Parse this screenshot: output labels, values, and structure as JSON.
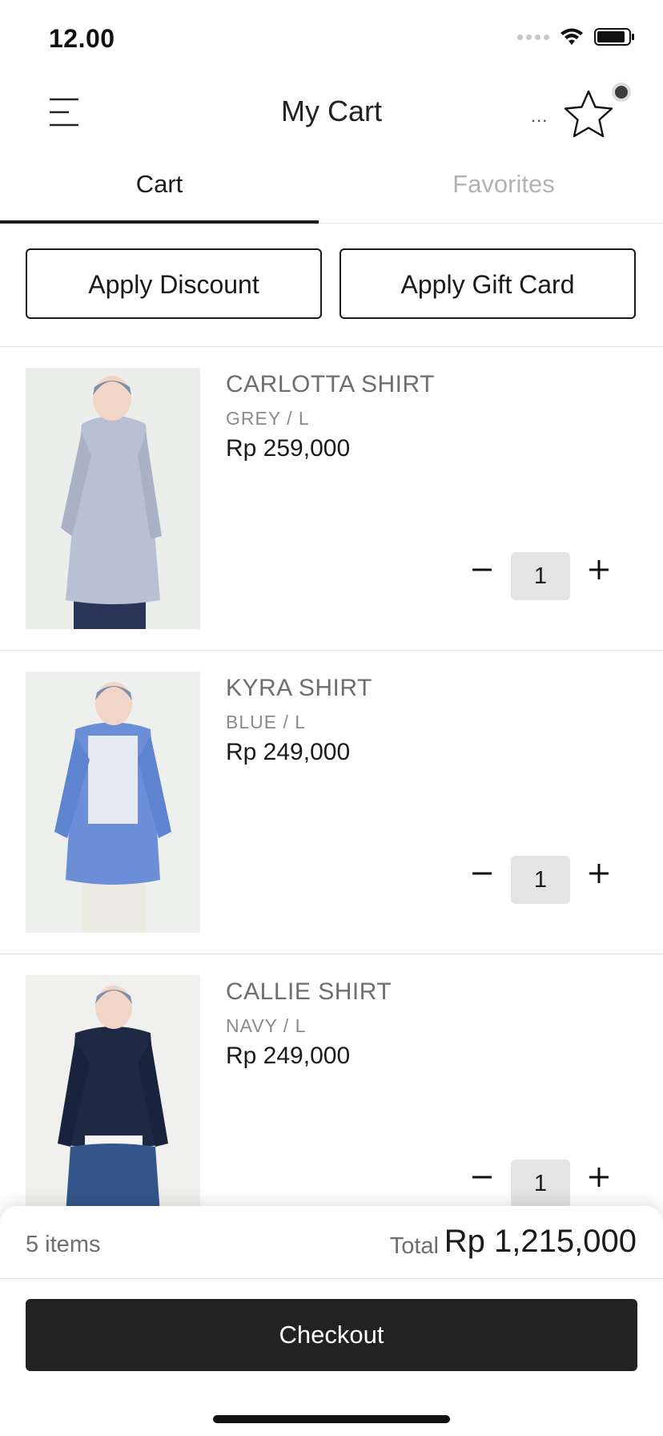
{
  "status_bar": {
    "time": "12.00"
  },
  "header": {
    "title": "My Cart",
    "more": "..."
  },
  "tabs": [
    {
      "label": "Cart",
      "active": true
    },
    {
      "label": "Favorites",
      "active": false
    }
  ],
  "actions": {
    "discount_label": "Apply Discount",
    "gift_label": "Apply Gift Card"
  },
  "items": [
    {
      "name": "CARLOTTA SHIRT",
      "variant": "GREY / L",
      "price": "Rp 259,000",
      "qty": "1"
    },
    {
      "name": "KYRA SHIRT",
      "variant": "BLUE / L",
      "price": "Rp 249,000",
      "qty": "1"
    },
    {
      "name": "CALLIE SHIRT",
      "variant": "NAVY / L",
      "price": "Rp 249,000",
      "qty": "1"
    }
  ],
  "summary": {
    "items_count": "5 items",
    "total_label": "Total",
    "total_value": "Rp 1,215,000",
    "checkout_label": "Checkout"
  },
  "colors": {
    "accent": "#222222",
    "tab_inactive": "#b3b3b3",
    "qty_bg": "#e4e4e4"
  },
  "icons": [
    "menu-icon",
    "more-icon",
    "star-icon",
    "minus-icon",
    "plus-icon",
    "wifi-icon",
    "battery-icon"
  ]
}
